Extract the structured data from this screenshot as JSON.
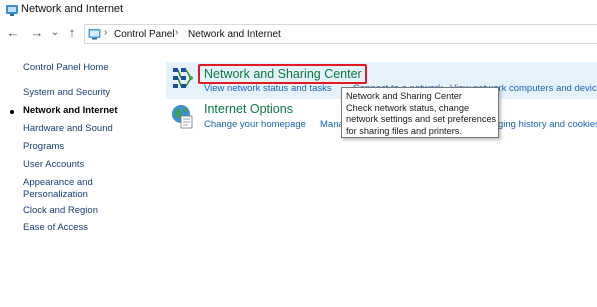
{
  "window": {
    "title": "Network and Internet"
  },
  "nav": {
    "back": "←",
    "forward": "→",
    "recent": "⌄",
    "up": "↑",
    "breadcrumb": [
      "Control Panel",
      "Network and Internet"
    ],
    "separator": "›"
  },
  "sidebar": {
    "items": [
      {
        "label": "Control Panel Home"
      },
      {
        "label": "System and Security"
      },
      {
        "label": "Network and Internet",
        "current": true
      },
      {
        "label": "Hardware and Sound"
      },
      {
        "label": "Programs"
      },
      {
        "label": "User Accounts"
      },
      {
        "label": "Appearance and"
      },
      {
        "label": "Personalization"
      },
      {
        "label": "Clock and Region"
      },
      {
        "label": "Ease of Access"
      }
    ]
  },
  "categories": [
    {
      "title": "Network and Sharing Center",
      "icon": "network-sharing-icon",
      "links": [
        "View network status and tasks",
        "Connect to a network",
        "View network computers and devices"
      ]
    },
    {
      "title": "Internet Options",
      "icon": "internet-options-icon",
      "links": [
        "Change your homepage",
        "Mana",
        "ging history and cookies"
      ]
    }
  ],
  "tooltip": {
    "lines": [
      "Network and Sharing Center",
      "Check network status, change",
      "network settings and set preferences",
      "for sharing files and printers."
    ]
  },
  "colors": {
    "category_title": "#0a7a3e",
    "link": "#1c63b8",
    "highlight": "#e6f2fb",
    "annotation_box": "#e01b24"
  }
}
